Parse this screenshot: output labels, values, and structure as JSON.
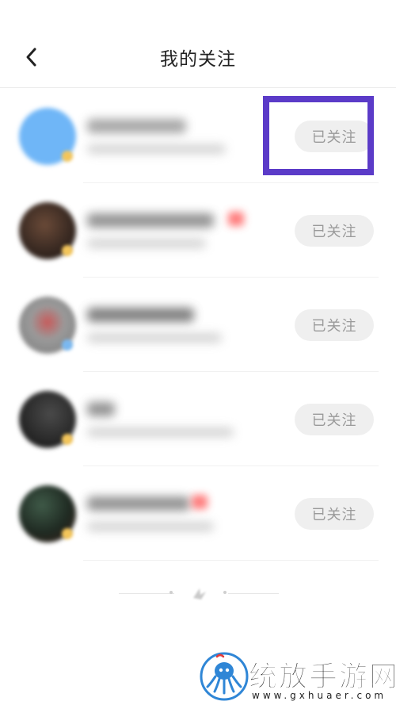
{
  "header": {
    "title": "我的关注",
    "back_icon": "chevron-left-icon"
  },
  "follow_list": [
    {
      "button_label": "已关注",
      "avatar_color": "#6fb6f7",
      "highlighted": true
    },
    {
      "button_label": "已关注",
      "avatar_color": "#3a2a22",
      "highlighted": false
    },
    {
      "button_label": "已关注",
      "avatar_color": "#8f8f8f",
      "highlighted": false
    },
    {
      "button_label": "已关注",
      "avatar_color": "#2b2b2b",
      "highlighted": false
    },
    {
      "button_label": "已关注",
      "avatar_color": "#1f2a22",
      "highlighted": false
    }
  ],
  "highlight": {
    "color": "#5b3bc8"
  },
  "watermark": {
    "title": "统放手游网",
    "domain": "www.gxhuaer.com"
  }
}
